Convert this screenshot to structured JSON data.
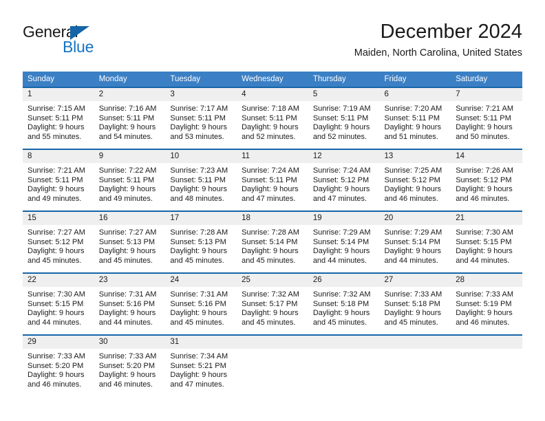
{
  "brand": {
    "name_part1": "General",
    "name_part2": "Blue",
    "accent_color": "#1573c4",
    "triangle_color": "#1565a8"
  },
  "header": {
    "title": "December 2024",
    "subtitle": "Maiden, North Carolina, United States"
  },
  "calendar": {
    "header_bg": "#3b7fc4",
    "row_border_color": "#1565a8",
    "daynum_bg": "#efefef",
    "weekdays": [
      "Sunday",
      "Monday",
      "Tuesday",
      "Wednesday",
      "Thursday",
      "Friday",
      "Saturday"
    ],
    "weeks": [
      [
        {
          "day": "1",
          "sunrise": "Sunrise: 7:15 AM",
          "sunset": "Sunset: 5:11 PM",
          "daylight1": "Daylight: 9 hours",
          "daylight2": "and 55 minutes."
        },
        {
          "day": "2",
          "sunrise": "Sunrise: 7:16 AM",
          "sunset": "Sunset: 5:11 PM",
          "daylight1": "Daylight: 9 hours",
          "daylight2": "and 54 minutes."
        },
        {
          "day": "3",
          "sunrise": "Sunrise: 7:17 AM",
          "sunset": "Sunset: 5:11 PM",
          "daylight1": "Daylight: 9 hours",
          "daylight2": "and 53 minutes."
        },
        {
          "day": "4",
          "sunrise": "Sunrise: 7:18 AM",
          "sunset": "Sunset: 5:11 PM",
          "daylight1": "Daylight: 9 hours",
          "daylight2": "and 52 minutes."
        },
        {
          "day": "5",
          "sunrise": "Sunrise: 7:19 AM",
          "sunset": "Sunset: 5:11 PM",
          "daylight1": "Daylight: 9 hours",
          "daylight2": "and 52 minutes."
        },
        {
          "day": "6",
          "sunrise": "Sunrise: 7:20 AM",
          "sunset": "Sunset: 5:11 PM",
          "daylight1": "Daylight: 9 hours",
          "daylight2": "and 51 minutes."
        },
        {
          "day": "7",
          "sunrise": "Sunrise: 7:21 AM",
          "sunset": "Sunset: 5:11 PM",
          "daylight1": "Daylight: 9 hours",
          "daylight2": "and 50 minutes."
        }
      ],
      [
        {
          "day": "8",
          "sunrise": "Sunrise: 7:21 AM",
          "sunset": "Sunset: 5:11 PM",
          "daylight1": "Daylight: 9 hours",
          "daylight2": "and 49 minutes."
        },
        {
          "day": "9",
          "sunrise": "Sunrise: 7:22 AM",
          "sunset": "Sunset: 5:11 PM",
          "daylight1": "Daylight: 9 hours",
          "daylight2": "and 49 minutes."
        },
        {
          "day": "10",
          "sunrise": "Sunrise: 7:23 AM",
          "sunset": "Sunset: 5:11 PM",
          "daylight1": "Daylight: 9 hours",
          "daylight2": "and 48 minutes."
        },
        {
          "day": "11",
          "sunrise": "Sunrise: 7:24 AM",
          "sunset": "Sunset: 5:11 PM",
          "daylight1": "Daylight: 9 hours",
          "daylight2": "and 47 minutes."
        },
        {
          "day": "12",
          "sunrise": "Sunrise: 7:24 AM",
          "sunset": "Sunset: 5:12 PM",
          "daylight1": "Daylight: 9 hours",
          "daylight2": "and 47 minutes."
        },
        {
          "day": "13",
          "sunrise": "Sunrise: 7:25 AM",
          "sunset": "Sunset: 5:12 PM",
          "daylight1": "Daylight: 9 hours",
          "daylight2": "and 46 minutes."
        },
        {
          "day": "14",
          "sunrise": "Sunrise: 7:26 AM",
          "sunset": "Sunset: 5:12 PM",
          "daylight1": "Daylight: 9 hours",
          "daylight2": "and 46 minutes."
        }
      ],
      [
        {
          "day": "15",
          "sunrise": "Sunrise: 7:27 AM",
          "sunset": "Sunset: 5:12 PM",
          "daylight1": "Daylight: 9 hours",
          "daylight2": "and 45 minutes."
        },
        {
          "day": "16",
          "sunrise": "Sunrise: 7:27 AM",
          "sunset": "Sunset: 5:13 PM",
          "daylight1": "Daylight: 9 hours",
          "daylight2": "and 45 minutes."
        },
        {
          "day": "17",
          "sunrise": "Sunrise: 7:28 AM",
          "sunset": "Sunset: 5:13 PM",
          "daylight1": "Daylight: 9 hours",
          "daylight2": "and 45 minutes."
        },
        {
          "day": "18",
          "sunrise": "Sunrise: 7:28 AM",
          "sunset": "Sunset: 5:14 PM",
          "daylight1": "Daylight: 9 hours",
          "daylight2": "and 45 minutes."
        },
        {
          "day": "19",
          "sunrise": "Sunrise: 7:29 AM",
          "sunset": "Sunset: 5:14 PM",
          "daylight1": "Daylight: 9 hours",
          "daylight2": "and 44 minutes."
        },
        {
          "day": "20",
          "sunrise": "Sunrise: 7:29 AM",
          "sunset": "Sunset: 5:14 PM",
          "daylight1": "Daylight: 9 hours",
          "daylight2": "and 44 minutes."
        },
        {
          "day": "21",
          "sunrise": "Sunrise: 7:30 AM",
          "sunset": "Sunset: 5:15 PM",
          "daylight1": "Daylight: 9 hours",
          "daylight2": "and 44 minutes."
        }
      ],
      [
        {
          "day": "22",
          "sunrise": "Sunrise: 7:30 AM",
          "sunset": "Sunset: 5:15 PM",
          "daylight1": "Daylight: 9 hours",
          "daylight2": "and 44 minutes."
        },
        {
          "day": "23",
          "sunrise": "Sunrise: 7:31 AM",
          "sunset": "Sunset: 5:16 PM",
          "daylight1": "Daylight: 9 hours",
          "daylight2": "and 44 minutes."
        },
        {
          "day": "24",
          "sunrise": "Sunrise: 7:31 AM",
          "sunset": "Sunset: 5:16 PM",
          "daylight1": "Daylight: 9 hours",
          "daylight2": "and 45 minutes."
        },
        {
          "day": "25",
          "sunrise": "Sunrise: 7:32 AM",
          "sunset": "Sunset: 5:17 PM",
          "daylight1": "Daylight: 9 hours",
          "daylight2": "and 45 minutes."
        },
        {
          "day": "26",
          "sunrise": "Sunrise: 7:32 AM",
          "sunset": "Sunset: 5:18 PM",
          "daylight1": "Daylight: 9 hours",
          "daylight2": "and 45 minutes."
        },
        {
          "day": "27",
          "sunrise": "Sunrise: 7:33 AM",
          "sunset": "Sunset: 5:18 PM",
          "daylight1": "Daylight: 9 hours",
          "daylight2": "and 45 minutes."
        },
        {
          "day": "28",
          "sunrise": "Sunrise: 7:33 AM",
          "sunset": "Sunset: 5:19 PM",
          "daylight1": "Daylight: 9 hours",
          "daylight2": "and 46 minutes."
        }
      ],
      [
        {
          "day": "29",
          "sunrise": "Sunrise: 7:33 AM",
          "sunset": "Sunset: 5:20 PM",
          "daylight1": "Daylight: 9 hours",
          "daylight2": "and 46 minutes."
        },
        {
          "day": "30",
          "sunrise": "Sunrise: 7:33 AM",
          "sunset": "Sunset: 5:20 PM",
          "daylight1": "Daylight: 9 hours",
          "daylight2": "and 46 minutes."
        },
        {
          "day": "31",
          "sunrise": "Sunrise: 7:34 AM",
          "sunset": "Sunset: 5:21 PM",
          "daylight1": "Daylight: 9 hours",
          "daylight2": "and 47 minutes."
        },
        {
          "day": "",
          "sunrise": "",
          "sunset": "",
          "daylight1": "",
          "daylight2": ""
        },
        {
          "day": "",
          "sunrise": "",
          "sunset": "",
          "daylight1": "",
          "daylight2": ""
        },
        {
          "day": "",
          "sunrise": "",
          "sunset": "",
          "daylight1": "",
          "daylight2": ""
        },
        {
          "day": "",
          "sunrise": "",
          "sunset": "",
          "daylight1": "",
          "daylight2": ""
        }
      ]
    ]
  }
}
